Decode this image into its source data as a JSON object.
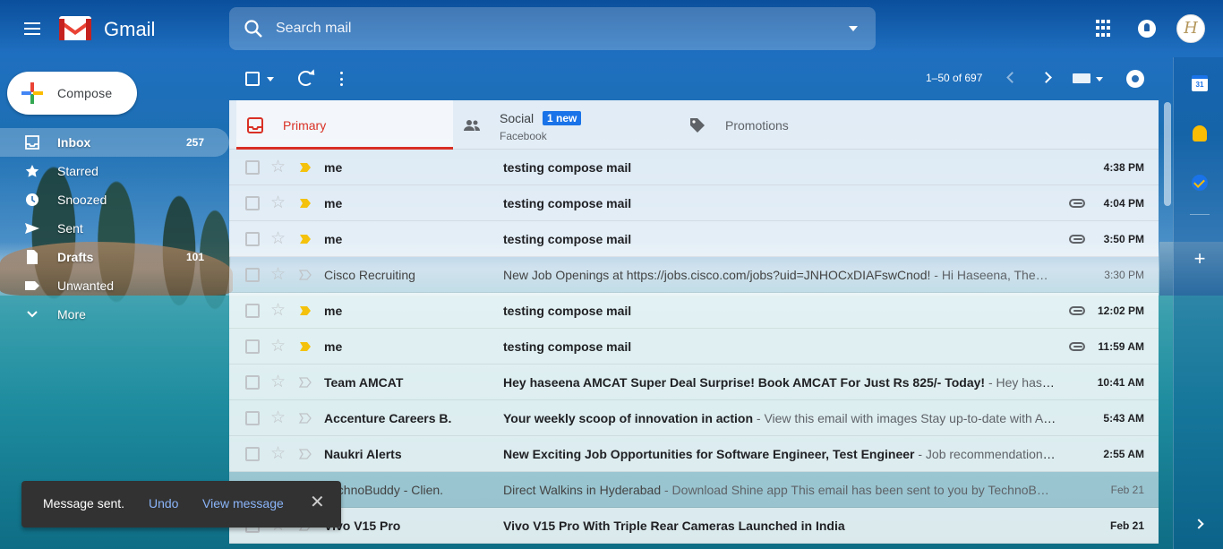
{
  "header": {
    "app_name": "Gmail",
    "search_placeholder": "Search mail",
    "avatar_initial": "H"
  },
  "compose": {
    "label": "Compose"
  },
  "nav": [
    {
      "key": "inbox",
      "label": "Inbox",
      "count": "257",
      "active": true
    },
    {
      "key": "starred",
      "label": "Starred",
      "count": ""
    },
    {
      "key": "snoozed",
      "label": "Snoozed",
      "count": ""
    },
    {
      "key": "sent",
      "label": "Sent",
      "count": ""
    },
    {
      "key": "drafts",
      "label": "Drafts",
      "count": "101"
    },
    {
      "key": "unwanted",
      "label": "Unwanted",
      "count": ""
    },
    {
      "key": "more",
      "label": "More",
      "count": ""
    }
  ],
  "toolbar": {
    "pager": "1–50 of 697"
  },
  "tabs": {
    "primary": {
      "label": "Primary"
    },
    "social": {
      "label": "Social",
      "badge": "1 new",
      "sub": "Facebook"
    },
    "promotions": {
      "label": "Promotions"
    }
  },
  "emails": [
    {
      "from": "me",
      "subject": "testing compose mail",
      "snippet": "",
      "time": "4:38 PM",
      "unread": true,
      "important": true,
      "attachment": false
    },
    {
      "from": "me",
      "subject": "testing compose mail",
      "snippet": "",
      "time": "4:04 PM",
      "unread": true,
      "important": true,
      "attachment": true
    },
    {
      "from": "me",
      "subject": "testing compose mail",
      "snippet": "",
      "time": "3:50 PM",
      "unread": true,
      "important": true,
      "attachment": true
    },
    {
      "from": "Cisco Recruiting",
      "subject": "New Job Openings at https://jobs.cisco.com/jobs?uid=JNHOCxDIAFswCnod!",
      "snippet": " - Hi Haseena, The…",
      "time": "3:30 PM",
      "unread": false,
      "important": false,
      "attachment": false
    },
    {
      "from": "me",
      "subject": "testing compose mail",
      "snippet": "",
      "time": "12:02 PM",
      "unread": true,
      "important": true,
      "attachment": true
    },
    {
      "from": "me",
      "subject": "testing compose mail",
      "snippet": "",
      "time": "11:59 AM",
      "unread": true,
      "important": true,
      "attachment": true
    },
    {
      "from": "Team AMCAT",
      "subject": "Hey haseena AMCAT Super Deal Surprise! Book AMCAT For Just Rs 825/- Today!",
      "snippet": " - Hey haseen…",
      "time": "10:41 AM",
      "unread": true,
      "important": false,
      "attachment": false
    },
    {
      "from": "Accenture Careers B.",
      "subject": "Your weekly scoop of innovation in action",
      "snippet": " - View this email with images Stay up-to-date with Ac…",
      "time": "5:43 AM",
      "unread": true,
      "important": false,
      "attachment": false
    },
    {
      "from": "Naukri Alerts",
      "subject": "New Exciting Job Opportunities for Software Engineer, Test Engineer",
      "snippet": " - Job recommendations b…",
      "time": "2:55 AM",
      "unread": true,
      "important": false,
      "attachment": false
    },
    {
      "from": "TechnoBuddy - Clien.",
      "subject": "Direct Walkins in Hyderabad",
      "snippet": " - Download Shine app This email has been sent to you by TechnoB…",
      "time": "Feb 21",
      "unread": false,
      "important": false,
      "attachment": false
    },
    {
      "from": "Vivo V15 Pro",
      "subject": "Vivo V15 Pro With Triple Rear Cameras Launched in India",
      "snippet": "",
      "time": "Feb 21",
      "unread": true,
      "important": false,
      "attachment": false
    }
  ],
  "sidepanel": {
    "calendar_day": "31"
  },
  "snackbar": {
    "message": "Message sent.",
    "undo": "Undo",
    "view": "View message",
    "close": "✕"
  },
  "colors": {
    "accent_red": "#d93025",
    "link_blue": "#8ab4f8",
    "badge_blue": "#1a73e8",
    "important_yellow": "#f4c20d"
  }
}
